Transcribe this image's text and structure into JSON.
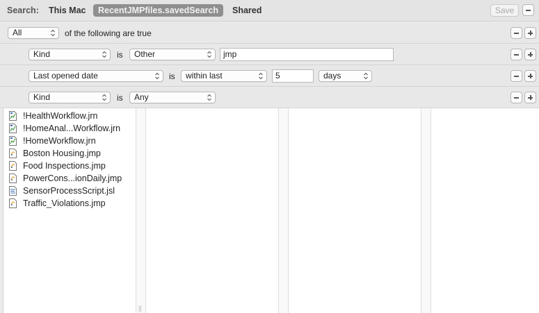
{
  "scope": {
    "label": "Search:",
    "this_mac": "This Mac",
    "saved_search": "RecentJMPfiles.savedSearch",
    "shared": "Shared",
    "save_label": "Save"
  },
  "criteria": {
    "match_selector": "All",
    "match_text": "of the following are true",
    "rows": [
      {
        "attribute": "Kind",
        "is_text": "is",
        "operator": "Other",
        "value": "jmp"
      },
      {
        "attribute": "Last opened date",
        "is_text": "is",
        "operator": "within last",
        "value": "5",
        "unit": "days"
      },
      {
        "attribute": "Kind",
        "is_text": "is",
        "operator": "Any"
      }
    ]
  },
  "results": {
    "files": [
      {
        "name": "!HealthWorkflow.jrn",
        "icon": "jrn-file-icon"
      },
      {
        "name": "!HomeAnal...Workflow.jrn",
        "icon": "jrn-file-icon"
      },
      {
        "name": "!HomeWorkflow.jrn",
        "icon": "jrn-file-icon"
      },
      {
        "name": "Boston Housing.jmp",
        "icon": "jmp-file-icon"
      },
      {
        "name": "Food Inspections.jmp",
        "icon": "jmp-file-icon"
      },
      {
        "name": "PowerCons...ionDaily.jmp",
        "icon": "jmp-file-icon"
      },
      {
        "name": "SensorProcessScript.jsl",
        "icon": "jsl-file-icon"
      },
      {
        "name": "Traffic_Violations.jmp",
        "icon": "jmp-file-icon"
      }
    ]
  },
  "colors": {
    "saved_search_bg": "#8f8f8f",
    "jmp_icon_accent": "#e8a93a",
    "jrn_icon_accent": "#4a9a4a",
    "jsl_icon_accent": "#3c6fb5"
  }
}
